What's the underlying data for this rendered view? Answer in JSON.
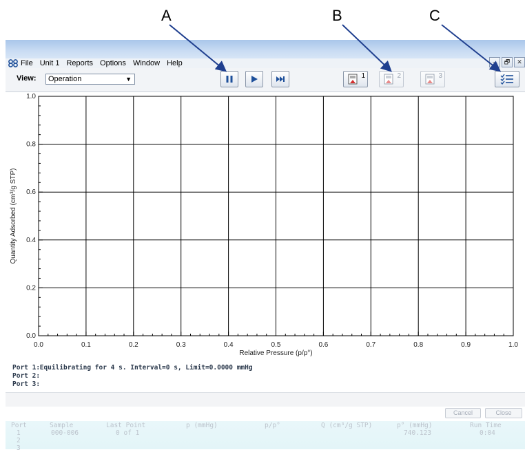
{
  "callouts": [
    {
      "label": "A"
    },
    {
      "label": "B"
    },
    {
      "label": "C"
    }
  ],
  "menu": [
    "File",
    "Unit 1",
    "Reports",
    "Options",
    "Window",
    "Help"
  ],
  "window_controls": [
    "–",
    "🗗",
    "✕"
  ],
  "toolbar": {
    "view_label": "View:",
    "view_value": "Operation",
    "report_buttons": [
      "1",
      "2",
      "3"
    ],
    "icons": {
      "pause": "pause-icon",
      "play": "play-icon",
      "skip": "skip-forward-icon",
      "report": "report-icon",
      "options": "checklist-icon"
    }
  },
  "chart_data": {
    "type": "line",
    "title": "",
    "xlabel": "Relative Pressure (p/p°)",
    "ylabel": "Quantity Adsorbed (cm³/g STP)",
    "xlim": [
      0.0,
      1.0
    ],
    "ylim": [
      0.0,
      1.0
    ],
    "x_ticks": [
      "0.0",
      "0.1",
      "0.2",
      "0.3",
      "0.4",
      "0.5",
      "0.6",
      "0.7",
      "0.8",
      "0.9",
      "1.0"
    ],
    "y_ticks": [
      "0.0",
      "0.2",
      "0.4",
      "0.6",
      "0.8",
      "1.0"
    ],
    "grid": true,
    "series": []
  },
  "status": [
    {
      "port": "Port 1:",
      "text": "Equilibrating for 4 s. Interval=0 s, Limit=0.0000 mmHg"
    },
    {
      "port": "Port 2:",
      "text": ""
    },
    {
      "port": "Port 3:",
      "text": ""
    }
  ],
  "buttons": {
    "cancel": "Cancel",
    "close": "Close"
  },
  "table": {
    "headers": [
      "Port",
      "Sample",
      "Last Point",
      "p (mmHg)",
      "p/p°",
      "Q (cm³/g STP)",
      "p° (mmHg)",
      "Run Time"
    ],
    "rows": [
      [
        "1",
        "000-006",
        "0 of 1",
        "",
        "",
        "",
        "740.123",
        "0:04"
      ],
      [
        "2",
        "",
        "",
        "",
        "",
        "",
        "",
        ""
      ],
      [
        "3",
        "",
        "",
        "",
        "",
        "",
        "",
        ""
      ]
    ]
  },
  "colors": {
    "arrow": "#1f3f8f",
    "report_red": "#d32f2f",
    "play_blue": "#1d4f9a",
    "status_text": "#2c3a4d"
  }
}
